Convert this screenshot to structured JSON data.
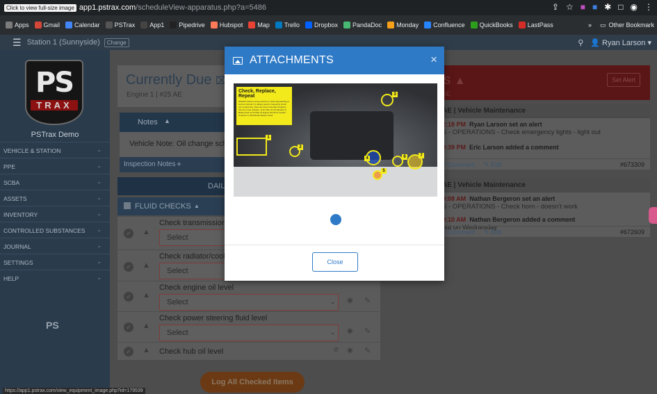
{
  "browser": {
    "fullsize_hint": "Click to view full-size image",
    "url_host": "app1.pstrax.com",
    "url_path": "/scheduleView-apparatus.php?a=5486",
    "bookmarks": [
      {
        "label": "Apps",
        "color": "#7b7b7b"
      },
      {
        "label": "Gmail",
        "color": "#d44638"
      },
      {
        "label": "Calendar",
        "color": "#4285f4"
      },
      {
        "label": "PSTrax",
        "color": "#555555"
      },
      {
        "label": "App1",
        "color": "#444444"
      },
      {
        "label": "Pipedrive",
        "color": "#222222"
      },
      {
        "label": "Hubspot",
        "color": "#ff7a59"
      },
      {
        "label": "Map",
        "color": "#ea4335"
      },
      {
        "label": "Trello",
        "color": "#0079bf"
      },
      {
        "label": "Dropbox",
        "color": "#0061ff"
      },
      {
        "label": "PandaDoc",
        "color": "#47b972"
      },
      {
        "label": "Monday",
        "color": "#f6a01a"
      },
      {
        "label": "Confluence",
        "color": "#2684ff"
      },
      {
        "label": "QuickBooks",
        "color": "#2ca01c"
      },
      {
        "label": "LastPass",
        "color": "#d32d27"
      }
    ],
    "other_bookmarks": "Other Bookmark",
    "more": "»"
  },
  "topbar": {
    "station": "Station 1 (Sunnyside)",
    "change": "Change",
    "user": "Ryan Larson"
  },
  "sidebar": {
    "logo_ps": "PS",
    "logo_trax": "TRAX",
    "org": "PSTrax Demo",
    "items": [
      "VEHICLE & STATION",
      "PPE",
      "SCBA",
      "ASSETS",
      "INVENTORY",
      "CONTROLLED SUBSTANCES",
      "JOURNAL",
      "SETTINGS",
      "HELP"
    ],
    "footer_logo": "PS"
  },
  "main": {
    "currently_due": "Currently Due",
    "vehicle": "Engine 1 | #25 AE",
    "notes": "Notes",
    "vehicle_note": "Vehicle Note: Oil change sche",
    "inspection_notes": "Inspection Notes",
    "daily": "DAIL",
    "fluid_checks": "FLUID CHECKS",
    "checks": [
      {
        "label": "Check transmission fl",
        "select": "Select"
      },
      {
        "label": "Check radiator/coolar",
        "select": "Select"
      },
      {
        "label": "Check engine oil level",
        "select": "Select"
      },
      {
        "label": "Check power steering fluid level",
        "select": "Select"
      },
      {
        "label": "Check hub oil level",
        "select": ""
      }
    ],
    "log_all": "Log All Checked Items"
  },
  "alerts": {
    "title": "rts",
    "set_alert": "Set Alert",
    "sub": "AE",
    "cards": [
      {
        "header": "AE | Vehicle Maintenance",
        "lines": [
          {
            "time": "2:18 PM",
            "who": "Ryan Larson set an alert",
            "text": "S - OPERATIONS - Check emergency lights - light out"
          },
          {
            "time": "0:39 PM",
            "who": "Eric Larson added a comment",
            "text": ""
          }
        ],
        "comment": "d Comment",
        "edit": "Edit",
        "id": "#673309"
      },
      {
        "header": "AE | Vehicle Maintenance",
        "lines": [
          {
            "time": "9:08 AM",
            "who": "Nathan Bergeron set an alert",
            "text": "S - OPERATIONS - Check horn - doesn't work"
          },
          {
            "time": "9:10 AM",
            "who": "Nathan Bergeron added a comment",
            "text": "out on Wednesday"
          }
        ],
        "comment": "d Comment",
        "edit": "Edit",
        "id": "#672609"
      }
    ]
  },
  "modal": {
    "title": "ATTACHMENTS",
    "close_x": "×",
    "image_note_title": "Check, Replace, Repeat",
    "image_note_text": "Whether before a long road trip or when approaching a service interval, it's always good to frequently check your engine bay. Here are some important locations found in most vehicles. 1) Air Filter 2) Oil Dipstick 3) Brake Fluid 4) Oil Filler 5) Engine Oil Fill 6) Coolant Overflow 7) Windshield Washer Fluid",
    "numbers": [
      "1",
      "2",
      "3",
      "4",
      "5",
      "6",
      "7"
    ],
    "close": "Close"
  },
  "status_url": "https://app1.pstrax.com/view_equipment_image.php?id=179539"
}
